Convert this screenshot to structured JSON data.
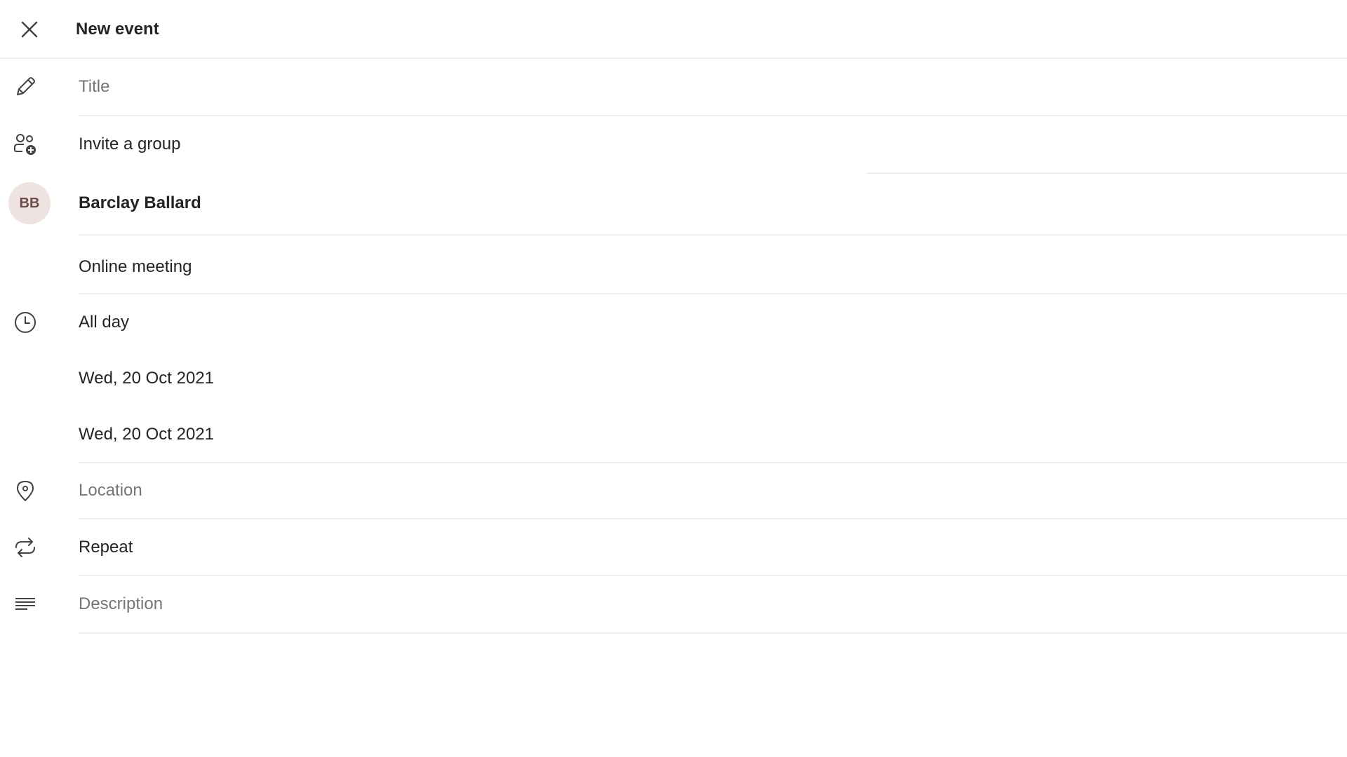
{
  "header": {
    "title": "New event",
    "close_icon": "close-icon"
  },
  "title_field": {
    "placeholder": "Title",
    "icon": "pencil-icon"
  },
  "invite": {
    "label": "Invite a group",
    "icon": "people-add-icon"
  },
  "attendee": {
    "initials": "BB",
    "name": "Barclay Ballard",
    "avatar_color": "#efe3e1"
  },
  "online_meeting": {
    "label": "Online meeting"
  },
  "time": {
    "icon": "clock-icon",
    "all_day_label": "All day",
    "start_date": "Wed, 20 Oct 2021",
    "end_date": "Wed, 20 Oct 2021"
  },
  "location": {
    "placeholder": "Location",
    "icon": "location-pin-icon"
  },
  "repeat": {
    "label": "Repeat",
    "icon": "repeat-icon"
  },
  "description": {
    "placeholder": "Description",
    "icon": "text-lines-icon"
  }
}
